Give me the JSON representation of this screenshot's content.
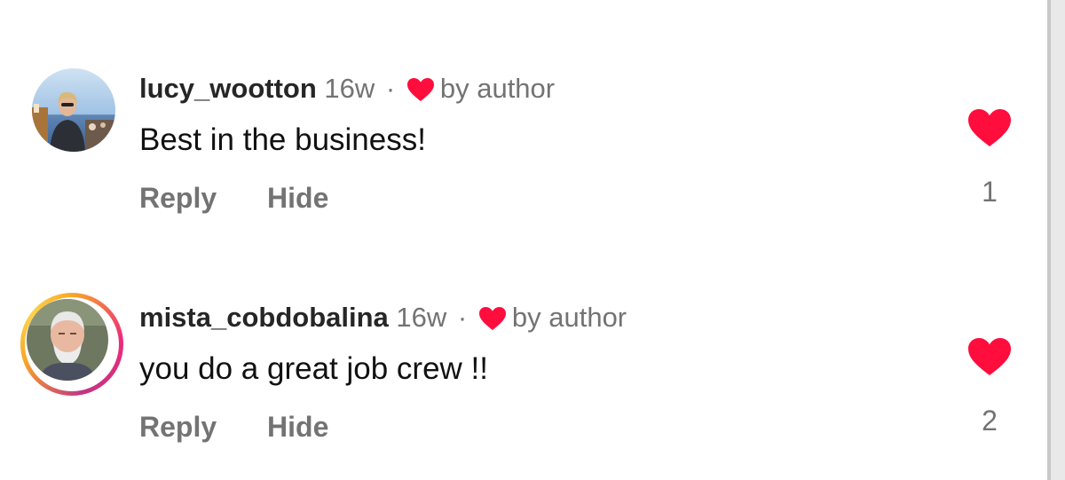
{
  "colors": {
    "heart": "#ff0d3d",
    "username": "#262626",
    "secondary": "#737373",
    "text": "#111111"
  },
  "comments": [
    {
      "username": "lucy_wootton",
      "time": "16w",
      "separator": "·",
      "liked_by_label": "by author",
      "text": "Best in the business!",
      "reply_label": "Reply",
      "hide_label": "Hide",
      "like_count": "1",
      "has_story_ring": false
    },
    {
      "username": "mista_cobdobalina",
      "time": "16w",
      "separator": "·",
      "liked_by_label": "by author",
      "text": "you do a great job crew !!",
      "reply_label": "Reply",
      "hide_label": "Hide",
      "like_count": "2",
      "has_story_ring": true
    }
  ]
}
